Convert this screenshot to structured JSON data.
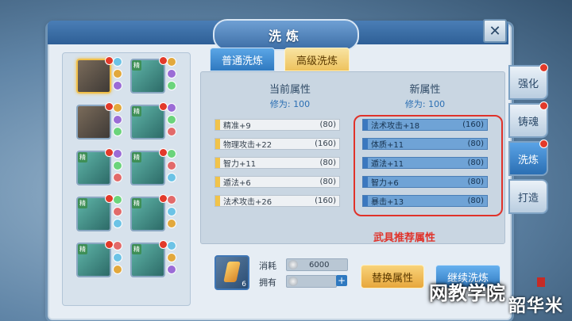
{
  "window": {
    "title": "洗炼",
    "close_label": "✕"
  },
  "tabs": [
    {
      "label": "普通洗炼",
      "active": false
    },
    {
      "label": "高级洗炼",
      "active": true
    }
  ],
  "side_tabs": [
    {
      "label": "强化",
      "active": false
    },
    {
      "label": "铸魂",
      "active": false
    },
    {
      "label": "洗炼",
      "active": true
    },
    {
      "label": "打造",
      "active": false
    }
  ],
  "slots": {
    "badge": "精",
    "orb_colors": [
      "#6cc3e6",
      "#e2a83c",
      "#9b6cd6",
      "#6bd47b",
      "#e26a6a"
    ]
  },
  "current": {
    "title": "当前属性",
    "cultivation": "修为: 100",
    "attributes": [
      {
        "name": "精准+9",
        "cap": "(80)"
      },
      {
        "name": "物理攻击+22",
        "cap": "(160)"
      },
      {
        "name": "智力+11",
        "cap": "(80)"
      },
      {
        "name": "遁法+6",
        "cap": "(80)"
      },
      {
        "name": "法术攻击+26",
        "cap": "(160)"
      }
    ]
  },
  "new": {
    "title": "新属性",
    "cultivation": "修为: 100",
    "attributes": [
      {
        "name": "法术攻击+18",
        "cap": "(160)"
      },
      {
        "name": "体质+11",
        "cap": "(80)"
      },
      {
        "name": "遁法+11",
        "cap": "(80)"
      },
      {
        "name": "智力+6",
        "cap": "(80)"
      },
      {
        "name": "暴击+13",
        "cap": "(80)"
      }
    ]
  },
  "recommend_label": "武具推荐属性",
  "cost": {
    "item_count": "6",
    "consume_label": "消耗",
    "consume_value": "6000",
    "own_label": "拥有",
    "own_value": "",
    "plus_label": "+"
  },
  "buttons": {
    "replace": "替换属性",
    "continue": "继续洗炼"
  },
  "watermark": {
    "text": "网教学院",
    "site": "韶华米"
  }
}
